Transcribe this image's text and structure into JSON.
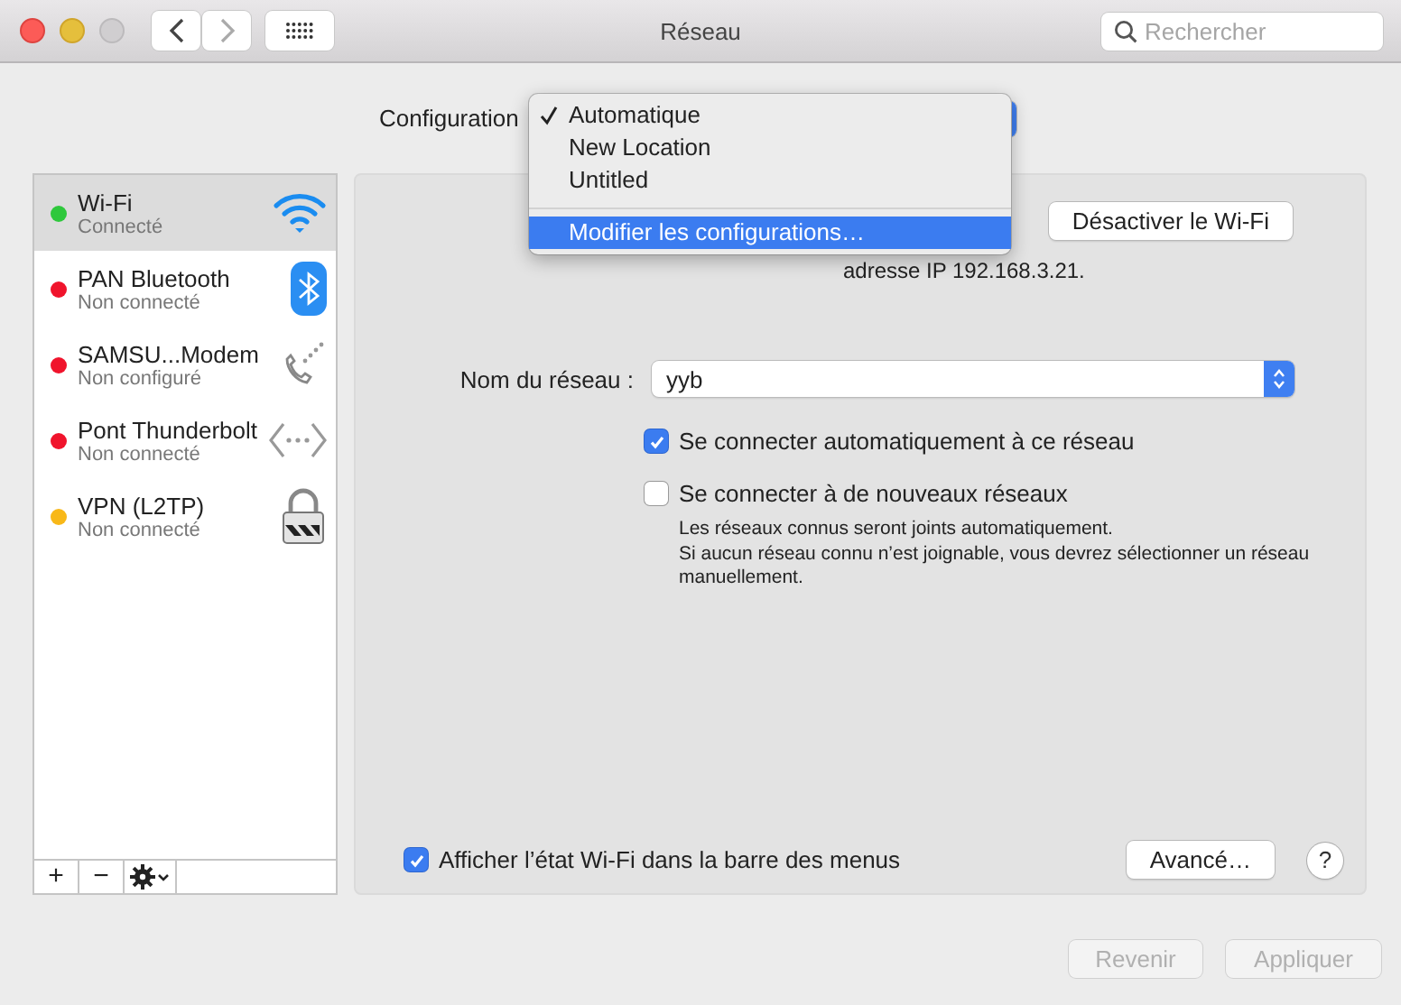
{
  "window": {
    "title": "Réseau",
    "search": {
      "placeholder": "Rechercher"
    }
  },
  "configuration": {
    "label": "Configuration",
    "menu": [
      {
        "label": "Automatique",
        "selected": true,
        "highlighted": false
      },
      {
        "label": "New Location",
        "selected": false,
        "highlighted": false
      },
      {
        "label": "Untitled",
        "selected": false,
        "highlighted": false
      },
      {
        "label": "Modifier les configurations…",
        "selected": false,
        "highlighted": true
      }
    ]
  },
  "services": [
    {
      "name": "Wi-Fi",
      "status": "Connecté",
      "color": "#2ec83c",
      "selected": true,
      "kind": "wifi"
    },
    {
      "name": "PAN Bluetooth",
      "status": "Non connecté",
      "color": "#f0142c",
      "selected": false,
      "kind": "bluetooth"
    },
    {
      "name": "SAMSU...Modem",
      "status": "Non configuré",
      "color": "#f0142c",
      "selected": false,
      "kind": "modem"
    },
    {
      "name": "Pont Thunderbolt",
      "status": "Non connecté",
      "color": "#f0142c",
      "selected": false,
      "kind": "bridge"
    },
    {
      "name": "VPN (L2TP)",
      "status": "Non connecté",
      "color": "#f8b818",
      "selected": false,
      "kind": "vpn"
    }
  ],
  "sidebar_toolbar": {
    "add": "+",
    "remove": "−"
  },
  "detail": {
    "toggle_button": "Désactiver le Wi-Fi",
    "status_text": "adresse IP 192.168.3.21.",
    "network": {
      "label": "Nom du réseau :",
      "value": "yyb"
    },
    "options": [
      {
        "label": "Se connecter automatiquement à ce réseau",
        "checked": true
      },
      {
        "label": "Se connecter à de nouveaux réseaux",
        "checked": false,
        "note": "Les réseaux connus seront joints automatiquement.\nSi aucun réseau connu n’est joignable, vous devrez sélectionner un réseau manuellement."
      }
    ],
    "show_in_menu": {
      "label": "Afficher l’état Wi-Fi dans la barre des menus",
      "checked": true
    },
    "advanced_button": "Avancé…",
    "help": "?"
  },
  "footer_buttons": [
    {
      "label": "Revenir",
      "disabled": true
    },
    {
      "label": "Appliquer",
      "disabled": true
    }
  ]
}
